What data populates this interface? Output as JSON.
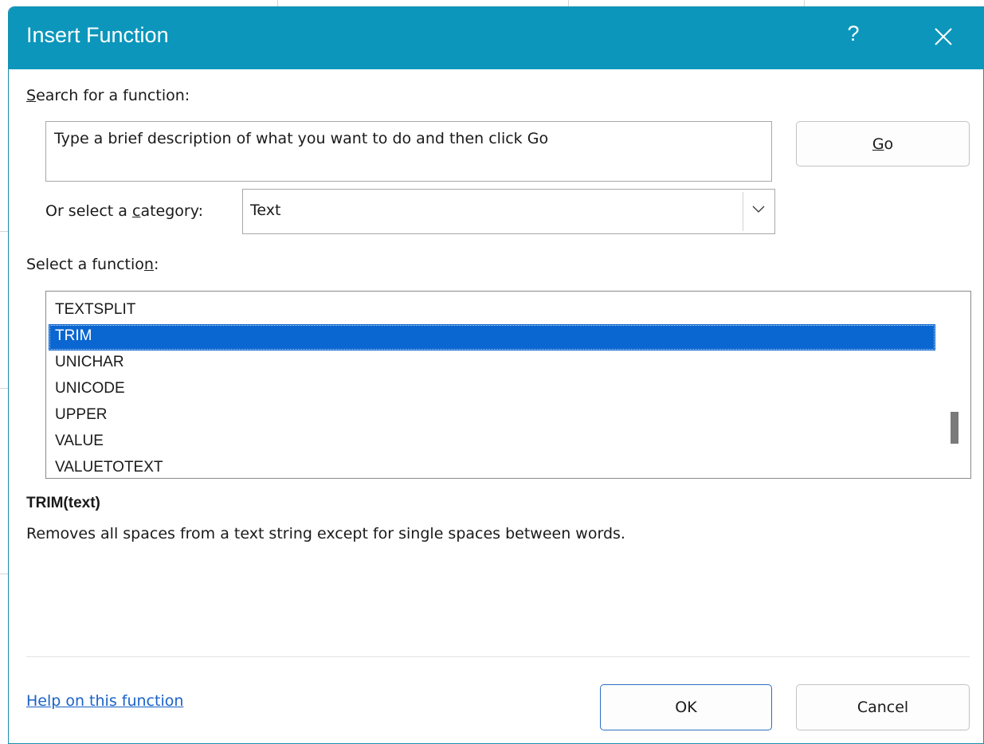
{
  "dialog": {
    "title": "Insert Function",
    "help_label": "?",
    "title_bar_color": "#0c96bb"
  },
  "search": {
    "label_accel": "S",
    "label_rest": "earch for a function:",
    "input_value": "Type a brief description of what you want to do and then click Go",
    "go_accel": "G",
    "go_rest": "o"
  },
  "category": {
    "label_before": "Or select a ",
    "label_accel": "c",
    "label_after": "ategory:",
    "selected": "Text"
  },
  "function_list": {
    "label_before": "Select a functio",
    "label_accel": "n",
    "label_after": ":",
    "items": [
      "TEXTSPLIT",
      "TRIM",
      "UNICHAR",
      "UNICODE",
      "UPPER",
      "VALUE",
      "VALUETOTEXT"
    ],
    "selected_item": "TRIM",
    "selection_color": "#0a66d0"
  },
  "details": {
    "signature": "TRIM(text)",
    "description": "Removes all spaces from a text string except for single spaces between words."
  },
  "footer": {
    "help_link": "Help on this function",
    "ok_label": "OK",
    "cancel_label": "Cancel"
  }
}
